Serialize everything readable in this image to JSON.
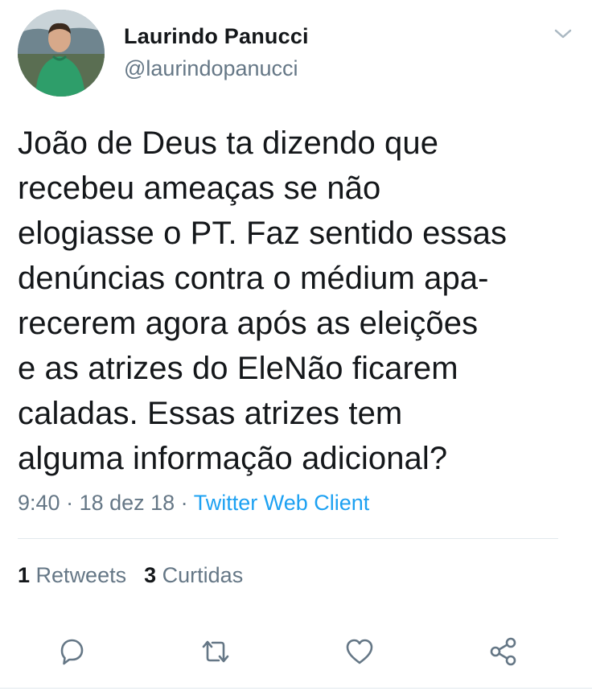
{
  "author": {
    "name": "Laurindo Panucci",
    "handle": "@laurindopanucci"
  },
  "tweet": {
    "lines": [
      "João de Deus ta dizendo que",
      "recebeu ameaças se não",
      "elogiasse o PT. Faz sentido essas",
      "denúncias contra o médium apa-",
      "recerem agora após as eleições",
      "e as atrizes do EleNão ficarem",
      "caladas. Essas atrizes tem",
      "alguma informação adicional?"
    ],
    "time": "9:40",
    "date": "18 dez 18",
    "separator": " · ",
    "source": "Twitter Web Client"
  },
  "stats": {
    "retweets_count": "1",
    "retweets_label": "Retweets",
    "likes_count": "3",
    "likes_label": "Curtidas"
  },
  "icons": {
    "menu": "chevron-down-icon",
    "reply": "reply-icon",
    "retweet": "retweet-icon",
    "like": "heart-icon",
    "share": "share-icon"
  },
  "colors": {
    "text": "#14171a",
    "secondary": "#657786",
    "link": "#1da1f2",
    "divider": "#e1e8ed"
  }
}
